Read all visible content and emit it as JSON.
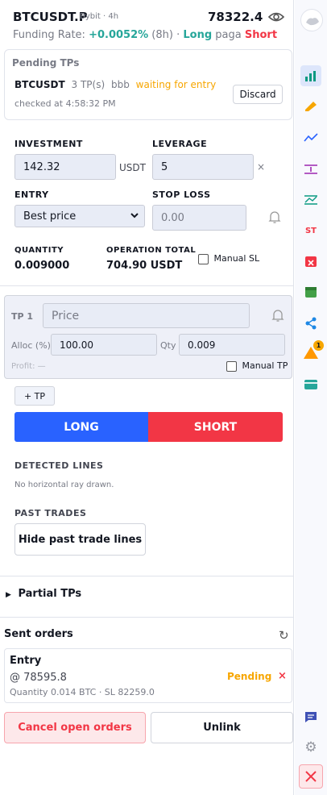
{
  "header": {
    "symbol": "BTCUSDT.P",
    "exchange_tf": "Bybit · 4h",
    "price": "78322.4",
    "funding_label": "Funding Rate:",
    "funding_rate": "+0.0052%",
    "funding_period": "(8h) ·",
    "long_text": "Long",
    "paga_text": "paga",
    "short_text": "Short"
  },
  "pending": {
    "title": "Pending TPs",
    "symbol": "BTCUSDT",
    "tp_count": "3 TP(s)",
    "tag": "bbb",
    "status": "waiting for entry",
    "checked": "checked at 4:58:32 PM",
    "discard_label": "Discard"
  },
  "form": {
    "investment_label": "INVESTMENT",
    "investment_value": "142.32",
    "investment_unit": "USDT",
    "leverage_label": "LEVERAGE",
    "leverage_value": "5",
    "leverage_suffix": "×",
    "entry_label": "ENTRY",
    "entry_selected": "Best price",
    "stoploss_label": "STOP LOSS",
    "stoploss_placeholder": "0.00",
    "quantity_label": "QUANTITY",
    "quantity_value": "0.009000",
    "optotal_label": "OPERATION TOTAL",
    "optotal_value": "704.90 USDT",
    "manual_sl_label": "Manual SL"
  },
  "tp1": {
    "label": "TP 1",
    "price_placeholder": "Price",
    "alloc_label": "Alloc (%)",
    "alloc_value": "100.00",
    "qty_label": "Qty",
    "qty_value": "0.009",
    "profit_label": "Profit: —",
    "manual_tp_label": "Manual TP"
  },
  "actions": {
    "add_tp_label": "+ TP",
    "long_label": "LONG",
    "short_label": "SHORT"
  },
  "lines": {
    "detected_title": "DETECTED LINES",
    "detected_empty": "No horizontal ray drawn.",
    "past_title": "PAST TRADES",
    "hide_label": "Hide past trade lines"
  },
  "partial": {
    "title": "Partial TPs"
  },
  "orders": {
    "title": "Sent orders",
    "entry_title": "Entry",
    "entry_price": "@ 78595.8",
    "entry_details": "Quantity 0.014 BTC · SL 82259.0",
    "entry_status": "Pending",
    "cancel_label": "Cancel open orders",
    "unlink_label": "Unlink"
  },
  "rail": {
    "badge_count": "1",
    "st_text": "ST"
  },
  "colors": {
    "long_blue": "#2962ff",
    "short_red": "#f23645",
    "green": "#26a69a",
    "orange": "#f7a600"
  }
}
